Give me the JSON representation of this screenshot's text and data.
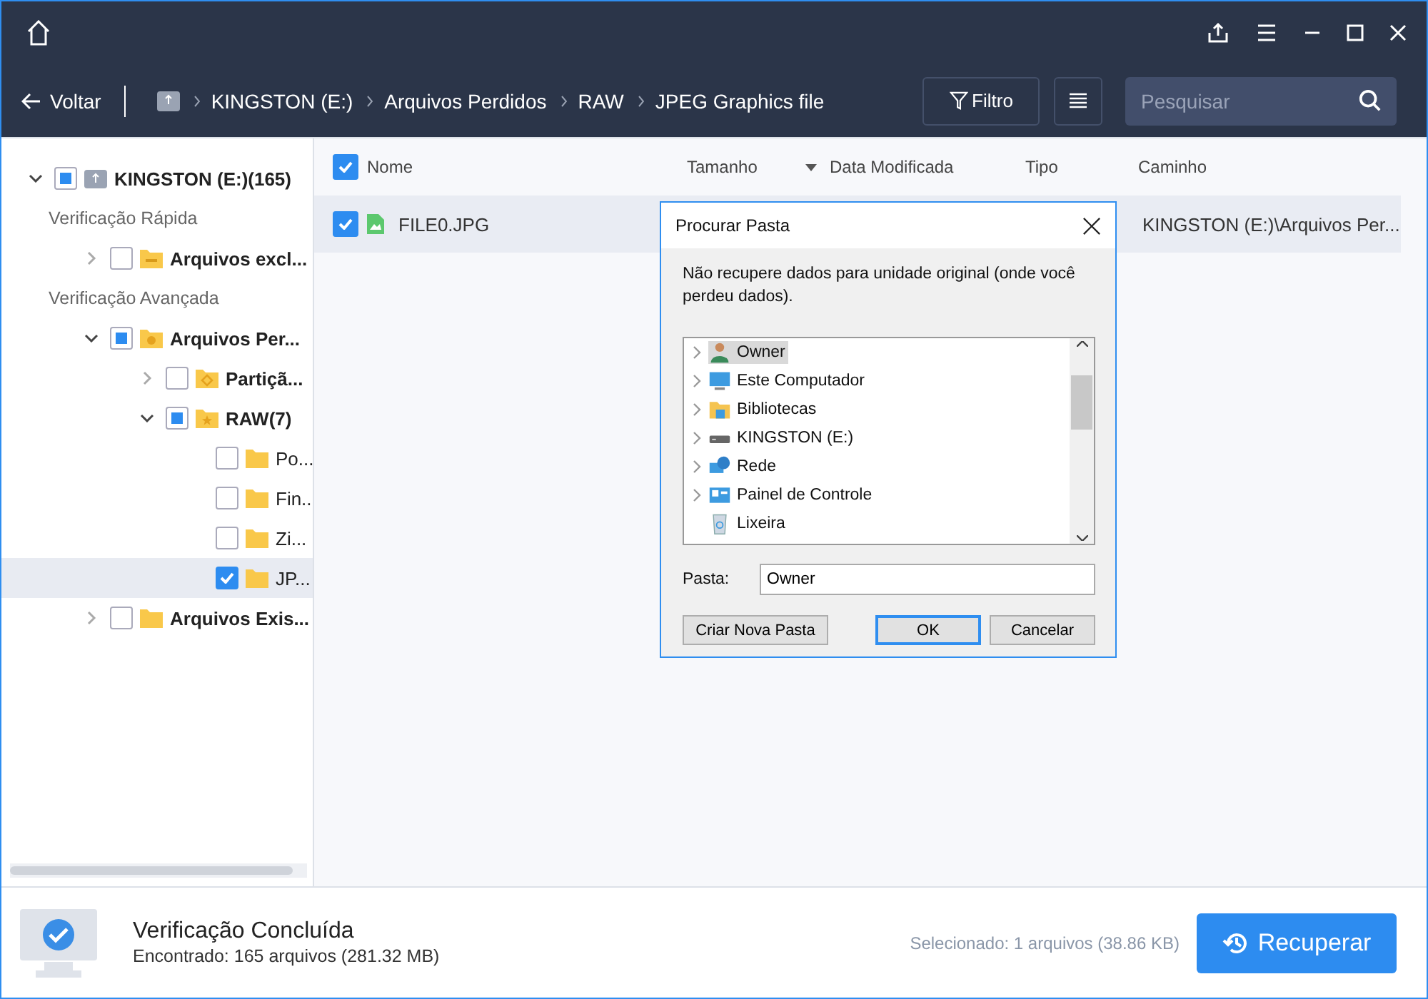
{
  "nav": {
    "back": "Voltar",
    "breadcrumb": [
      "KINGSTON (E:)",
      "Arquivos Perdidos",
      "RAW",
      "JPEG Graphics file"
    ],
    "filter": "Filtro",
    "search": {
      "placeholder": "Pesquisar"
    }
  },
  "sidebar": {
    "tree": [
      {
        "kind": "node",
        "label": "KINGSTON (E:)(165)",
        "expanded": true,
        "checked": false,
        "partial": true,
        "selected": false,
        "children": [
          {
            "kind": "section",
            "label": "Verificação Rápida"
          },
          {
            "kind": "node",
            "label": "Arquivos excl...",
            "expanded": false,
            "checked": false,
            "partial": false,
            "selected": false
          },
          {
            "kind": "section",
            "label": "Verificação Avançada"
          },
          {
            "kind": "node",
            "label": "Arquivos Per...",
            "expanded": true,
            "checked": false,
            "partial": true,
            "selected": false,
            "children": [
              {
                "kind": "node",
                "label": "Partiçã...",
                "expanded": false,
                "checked": false,
                "partial": false,
                "selected": false
              },
              {
                "kind": "node",
                "label": "RAW(7)",
                "expanded": true,
                "checked": false,
                "partial": true,
                "selected": false,
                "children": [
                  {
                    "kind": "leaf",
                    "label": "Po...",
                    "checked": false,
                    "partial": false,
                    "selected": false
                  },
                  {
                    "kind": "leaf",
                    "label": "Fin...",
                    "checked": false,
                    "partial": false,
                    "selected": false
                  },
                  {
                    "kind": "leaf",
                    "label": "Zi...",
                    "checked": false,
                    "partial": false,
                    "selected": false
                  },
                  {
                    "kind": "leaf",
                    "label": "JP...",
                    "checked": true,
                    "partial": false,
                    "selected": true
                  }
                ]
              }
            ]
          },
          {
            "kind": "node",
            "label": "Arquivos Exis...",
            "expanded": false,
            "checked": false,
            "partial": false,
            "selected": false
          }
        ]
      }
    ]
  },
  "table": {
    "all_checked": true,
    "columns": [
      "Nome",
      "Tamanho",
      "Data Modificada",
      "Tipo",
      "Caminho"
    ],
    "rows": [
      {
        "checked": true,
        "selected": true,
        "name": "FILE0.JPG",
        "path": "KINGSTON (E:)\\Arquivos Per..."
      }
    ]
  },
  "dialog": {
    "title": "Procurar Pasta",
    "message": "Não recupere dados para unidade original (onde você perdeu dados).",
    "items": [
      {
        "label": "Owner",
        "expandable": true,
        "selected": true
      },
      {
        "label": "Este Computador",
        "expandable": true,
        "selected": false
      },
      {
        "label": "Bibliotecas",
        "expandable": true,
        "selected": false
      },
      {
        "label": "KINGSTON (E:)",
        "expandable": true,
        "selected": false
      },
      {
        "label": "Rede",
        "expandable": true,
        "selected": false
      },
      {
        "label": "Painel de Controle",
        "expandable": true,
        "selected": false
      },
      {
        "label": "Lixeira",
        "expandable": false,
        "selected": false
      }
    ],
    "folder_label": "Pasta:",
    "folder_value": "Owner",
    "buttons": [
      "Criar Nova Pasta",
      "OK",
      "Cancelar"
    ]
  },
  "footer": {
    "title": "Verificação Concluída",
    "found": "Encontrado: 165 arquivos (281.32 MB)",
    "selected_info": "Selecionado: 1 arquivos (38.86 KB)",
    "recover": "Recuperar"
  }
}
